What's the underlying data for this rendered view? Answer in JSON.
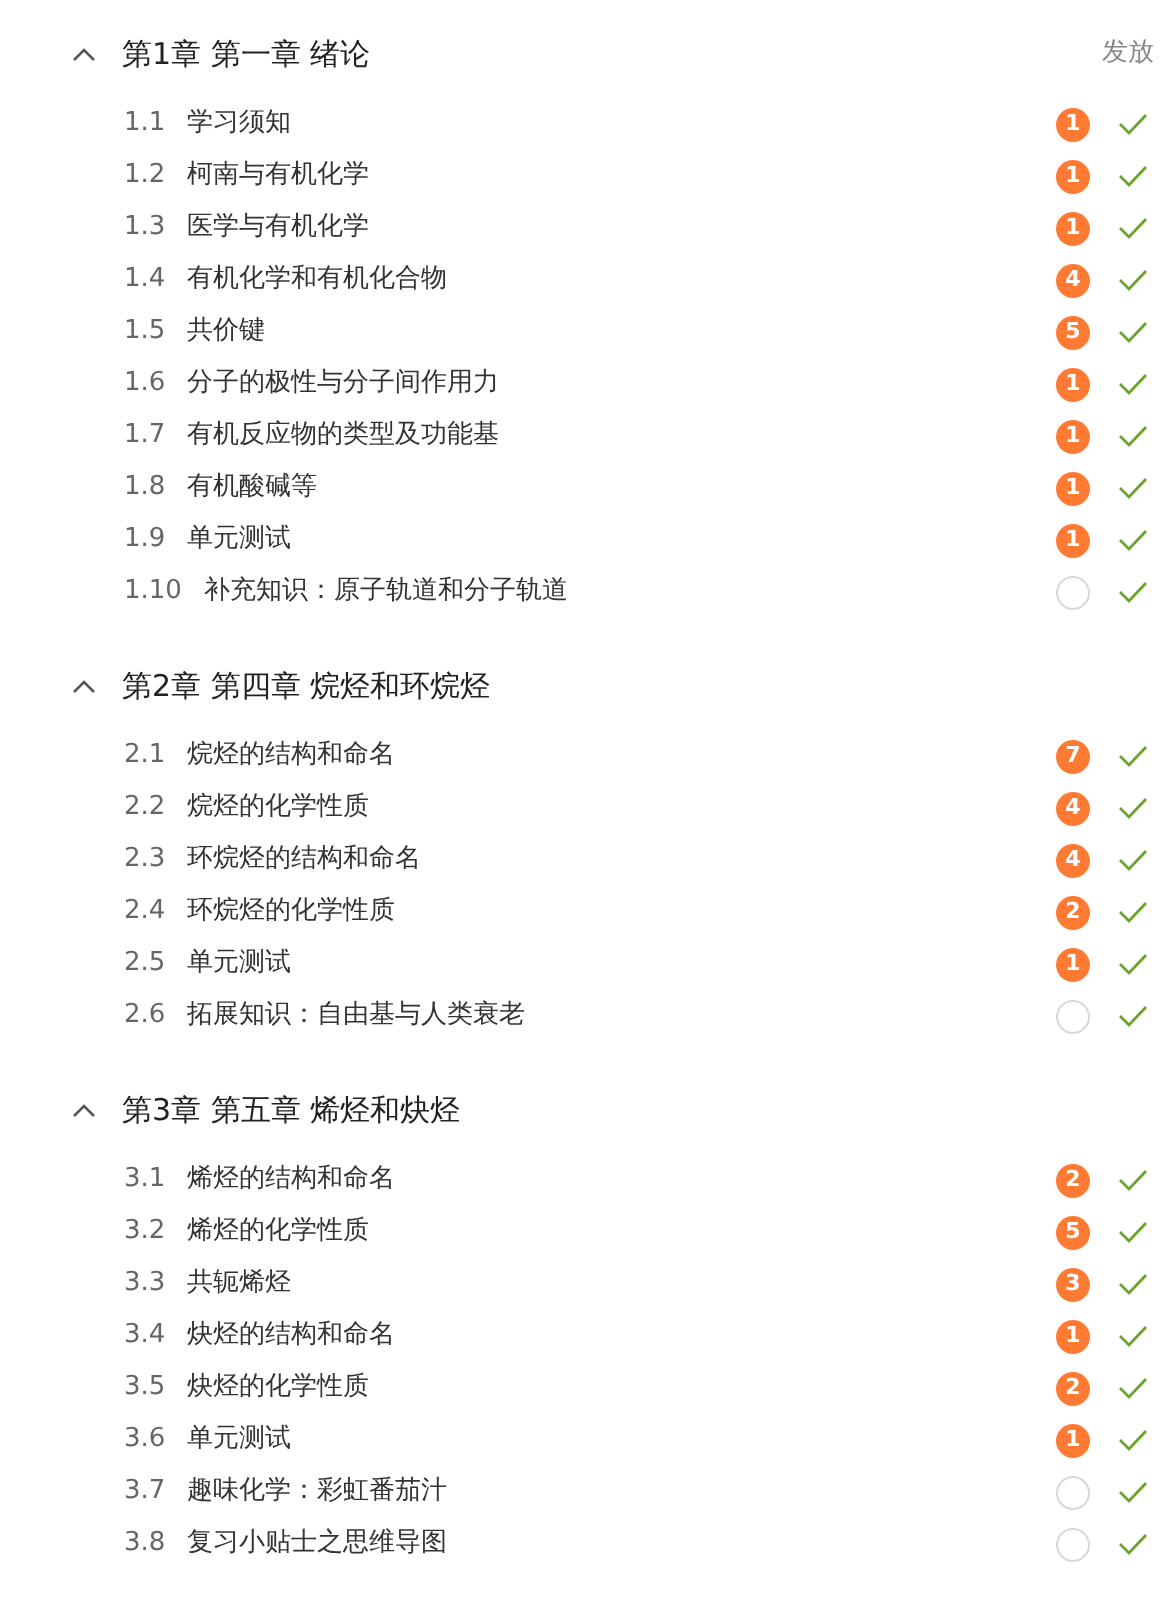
{
  "chapters": [
    {
      "title": "第1章 第一章 绪论",
      "expanded": true,
      "action": "发放",
      "lessons": [
        {
          "number": "1.1",
          "title": "学习须知",
          "count": "1",
          "done": true
        },
        {
          "number": "1.2",
          "title": "柯南与有机化学",
          "count": "1",
          "done": true
        },
        {
          "number": "1.3",
          "title": "医学与有机化学",
          "count": "1",
          "done": true
        },
        {
          "number": "1.4",
          "title": "有机化学和有机化合物",
          "count": "4",
          "done": true
        },
        {
          "number": "1.5",
          "title": "共价键",
          "count": "5",
          "done": true
        },
        {
          "number": "1.6",
          "title": "分子的极性与分子间作用力",
          "count": "1",
          "done": true
        },
        {
          "number": "1.7",
          "title": "有机反应物的类型及功能基",
          "count": "1",
          "done": true
        },
        {
          "number": "1.8",
          "title": "有机酸碱等",
          "count": "1",
          "done": true
        },
        {
          "number": "1.9",
          "title": "单元测试",
          "count": "1",
          "done": true
        },
        {
          "number": "1.10",
          "title": "补充知识：原子轨道和分子轨道",
          "done": true
        }
      ]
    },
    {
      "title": "第2章 第四章 烷烃和环烷烃",
      "expanded": true,
      "lessons": [
        {
          "number": "2.1",
          "title": "烷烃的结构和命名",
          "count": "7",
          "done": true
        },
        {
          "number": "2.2",
          "title": "烷烃的化学性质",
          "count": "4",
          "done": true
        },
        {
          "number": "2.3",
          "title": "环烷烃的结构和命名",
          "count": "4",
          "done": true
        },
        {
          "number": "2.4",
          "title": "环烷烃的化学性质",
          "count": "2",
          "done": true
        },
        {
          "number": "2.5",
          "title": "单元测试",
          "count": "1",
          "done": true
        },
        {
          "number": "2.6",
          "title": "拓展知识：自由基与人类衰老",
          "done": true
        }
      ]
    },
    {
      "title": "第3章 第五章 烯烃和炔烃",
      "expanded": true,
      "lessons": [
        {
          "number": "3.1",
          "title": "烯烃的结构和命名",
          "count": "2",
          "done": true
        },
        {
          "number": "3.2",
          "title": "烯烃的化学性质",
          "count": "5",
          "done": true
        },
        {
          "number": "3.3",
          "title": "共轭烯烃",
          "count": "3",
          "done": true
        },
        {
          "number": "3.4",
          "title": "炔烃的结构和命名",
          "count": "1",
          "done": true
        },
        {
          "number": "3.5",
          "title": "炔烃的化学性质",
          "count": "2",
          "done": true
        },
        {
          "number": "3.6",
          "title": "单元测试",
          "count": "1",
          "done": true
        },
        {
          "number": "3.7",
          "title": "趣味化学：彩虹番茄汁",
          "done": true
        },
        {
          "number": "3.8",
          "title": "复习小贴士之思维导图",
          "done": true
        }
      ]
    }
  ]
}
